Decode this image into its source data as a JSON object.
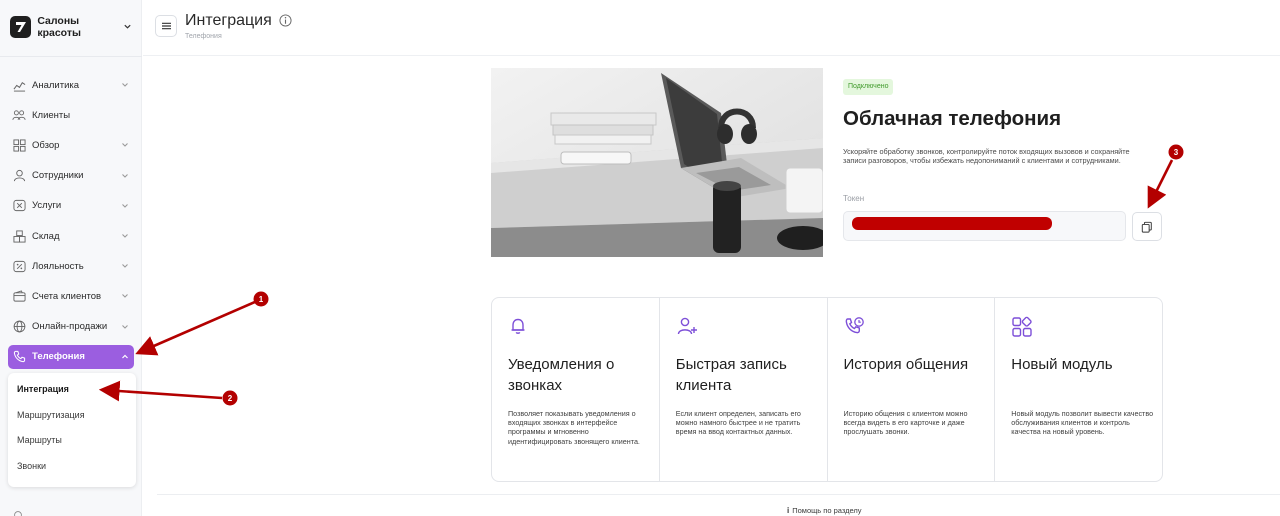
{
  "sidebar": {
    "org_name": "Салоны красоты",
    "items": [
      {
        "label": "Аналитика",
        "icon": "analytics-icon",
        "has_chevron": true
      },
      {
        "label": "Клиенты",
        "icon": "clients-icon",
        "has_chevron": false
      },
      {
        "label": "Обзор",
        "icon": "overview-icon",
        "has_chevron": true
      },
      {
        "label": "Сотрудники",
        "icon": "staff-icon",
        "has_chevron": true
      },
      {
        "label": "Услуги",
        "icon": "services-icon",
        "has_chevron": true
      },
      {
        "label": "Склад",
        "icon": "warehouse-icon",
        "has_chevron": true
      },
      {
        "label": "Лояльность",
        "icon": "loyalty-icon",
        "has_chevron": true
      },
      {
        "label": "Счета клиентов",
        "icon": "wallet-icon",
        "has_chevron": true
      },
      {
        "label": "Онлайн-продажи",
        "icon": "globe-icon",
        "has_chevron": true
      },
      {
        "label": "Телефония",
        "icon": "phone-icon",
        "has_chevron": true,
        "active": true
      }
    ],
    "submenu": [
      "Интеграция",
      "Маршрутизация",
      "Маршруты",
      "Звонки"
    ],
    "submenu_current": "Интеграция"
  },
  "header": {
    "title": "Интеграция",
    "breadcrumb": "Телефония"
  },
  "hero": {
    "status": "Подключено",
    "title": "Облачная телефония",
    "description": "Ускоряйте обработку звонков, контролируйте поток входящих вызовов и сохраняйте записи разговоров, чтобы избежать недопониманий с клиентами и сотрудниками.",
    "token_label": "Токен",
    "image": "laptop-desk-photo"
  },
  "cards": [
    {
      "icon": "bell-icon",
      "title": "Уведомления о звонках",
      "description": "Позволяет показывать уведомления о входящих звонках в интерфейсе программы и мгновенно идентифицировать звонящего клиента."
    },
    {
      "icon": "user-plus-icon",
      "title": "Быстрая запись клиента",
      "description": "Если клиент определен, записать его можно намного быстрее и не тратить время на ввод контактных данных."
    },
    {
      "icon": "phone-history-icon",
      "title": "История общения",
      "description": "Историю общения с клиентом можно всегда видеть в его карточке и даже прослушать звонки."
    },
    {
      "icon": "modules-icon",
      "title": "Новый модуль",
      "description": "Новый модуль позволит вывести качество обслуживания клиентов и контроль качества на новый уровень."
    }
  ],
  "footer": {
    "help": "Помощь по разделу"
  },
  "annotations": {
    "markers": [
      "1",
      "2",
      "3"
    ],
    "color": "#b30000"
  },
  "colors": {
    "accent": "#9b5ee0",
    "status_bg": "#e4f7dd",
    "status_text": "#3f9a2a",
    "redaction": "#c00000"
  }
}
